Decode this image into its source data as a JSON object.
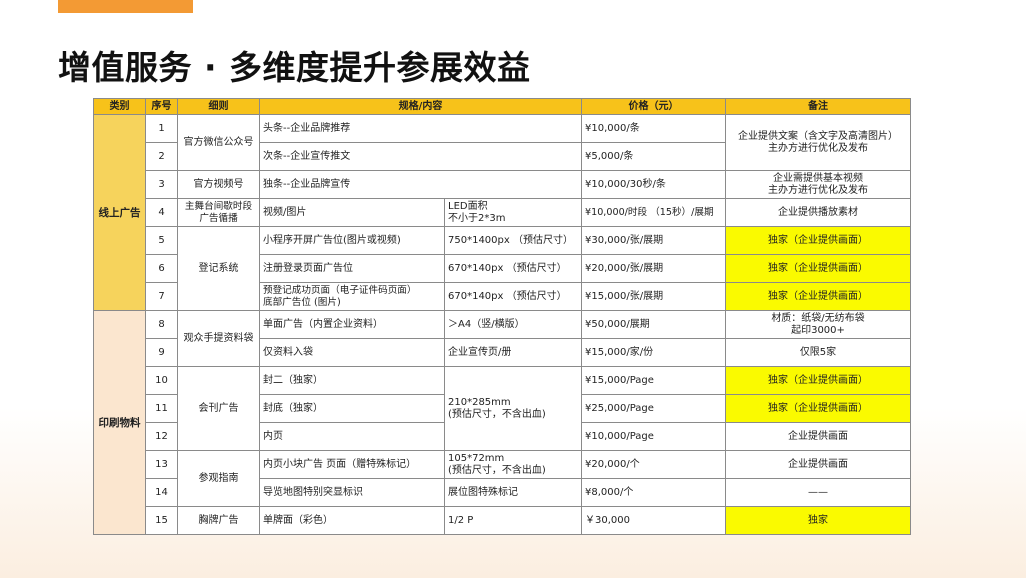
{
  "title": "增值服务 · 多维度提升参展效益",
  "table": {
    "headers": [
      "类别",
      "序号",
      "细则",
      "规格/内容",
      "价格（元）",
      "备注"
    ],
    "categories": {
      "online": "线上广告",
      "print": "印刷物料"
    },
    "rows": [
      {
        "no": "1",
        "detail": "官方微信公众号",
        "spec": "头条--企业品牌推荐",
        "price": "¥10,000/条",
        "note": "企业提供文案（含文字及高清图片）\n主办方进行优化及发布"
      },
      {
        "no": "2",
        "detail": "",
        "spec": "次条--企业宣传推文",
        "price": "¥5,000/条",
        "note": ""
      },
      {
        "no": "3",
        "detail": "官方视频号",
        "spec": "独条--企业品牌宣传",
        "price": "¥10,000/30秒/条",
        "note": "企业需提供基本视频\n主办方进行优化及发布"
      },
      {
        "no": "4",
        "detail": "主舞台间歇时段\n广告循播",
        "spec": "视频/图片",
        "size": "LED面积\n不小于2*3m",
        "price": "¥10,000/时段 （15秒）/展期",
        "note": "企业提供播放素材"
      },
      {
        "no": "5",
        "detail": "登记系统",
        "spec": "小程序开屏广告位(图片或视频)",
        "size": "750*1400px （预估尺寸）",
        "price": "¥30,000/张/展期",
        "note": "独家（企业提供画面）"
      },
      {
        "no": "6",
        "detail": "",
        "spec": "注册登录页面广告位",
        "size": "670*140px （预估尺寸）",
        "price": "¥20,000/张/展期",
        "note": "独家（企业提供画面）"
      },
      {
        "no": "7",
        "detail": "",
        "spec": "预登记成功页面（电子证件码页面）\n底部广告位 (图片)",
        "size": "670*140px （预估尺寸）",
        "price": "¥15,000/张/展期",
        "note": "独家（企业提供画面）"
      },
      {
        "no": "8",
        "detail": "观众手提资料袋",
        "spec": "单面广告（内置企业资料）",
        "size": "＞A4（竖/横版）",
        "price": "¥50,000/展期",
        "note": "材质：纸袋/无纺布袋\n起印3000+"
      },
      {
        "no": "9",
        "detail": "",
        "spec": "仅资料入袋",
        "size": "企业宣传页/册",
        "price": "¥15,000/家/份",
        "note": "仅限5家"
      },
      {
        "no": "10",
        "detail": "会刊广告",
        "spec": "封二（独家）",
        "size": "210*285mm\n(预估尺寸，不含出血)",
        "price": "¥15,000/Page",
        "note": "独家（企业提供画面）"
      },
      {
        "no": "11",
        "detail": "",
        "spec": "封底（独家）",
        "price": "¥25,000/Page",
        "note": "独家（企业提供画面）"
      },
      {
        "no": "12",
        "detail": "",
        "spec": "内页",
        "price": "¥10,000/Page",
        "note": "企业提供画面"
      },
      {
        "no": "13",
        "detail": "参观指南",
        "spec": "内页小块广告 页面（赠特殊标记）",
        "size": "105*72mm\n(预估尺寸，不含出血)",
        "price": "¥20,000/个",
        "note": "企业提供画面"
      },
      {
        "no": "14",
        "detail": "",
        "spec": "导览地图特别突显标识",
        "size": "展位图特殊标记",
        "price": "¥8,000/个",
        "note": "——"
      },
      {
        "no": "15",
        "detail": "胸牌广告",
        "spec": "单牌面（彩色）",
        "size": "1/2 P",
        "price": "￥30,000",
        "note": "独家"
      }
    ]
  },
  "colors": {
    "accent_orange": "#f39a34",
    "header_yellow": "#f7c21a",
    "online_category": "#f6d35c",
    "print_category": "#fbe6cf",
    "highlight": "#fafa00"
  }
}
